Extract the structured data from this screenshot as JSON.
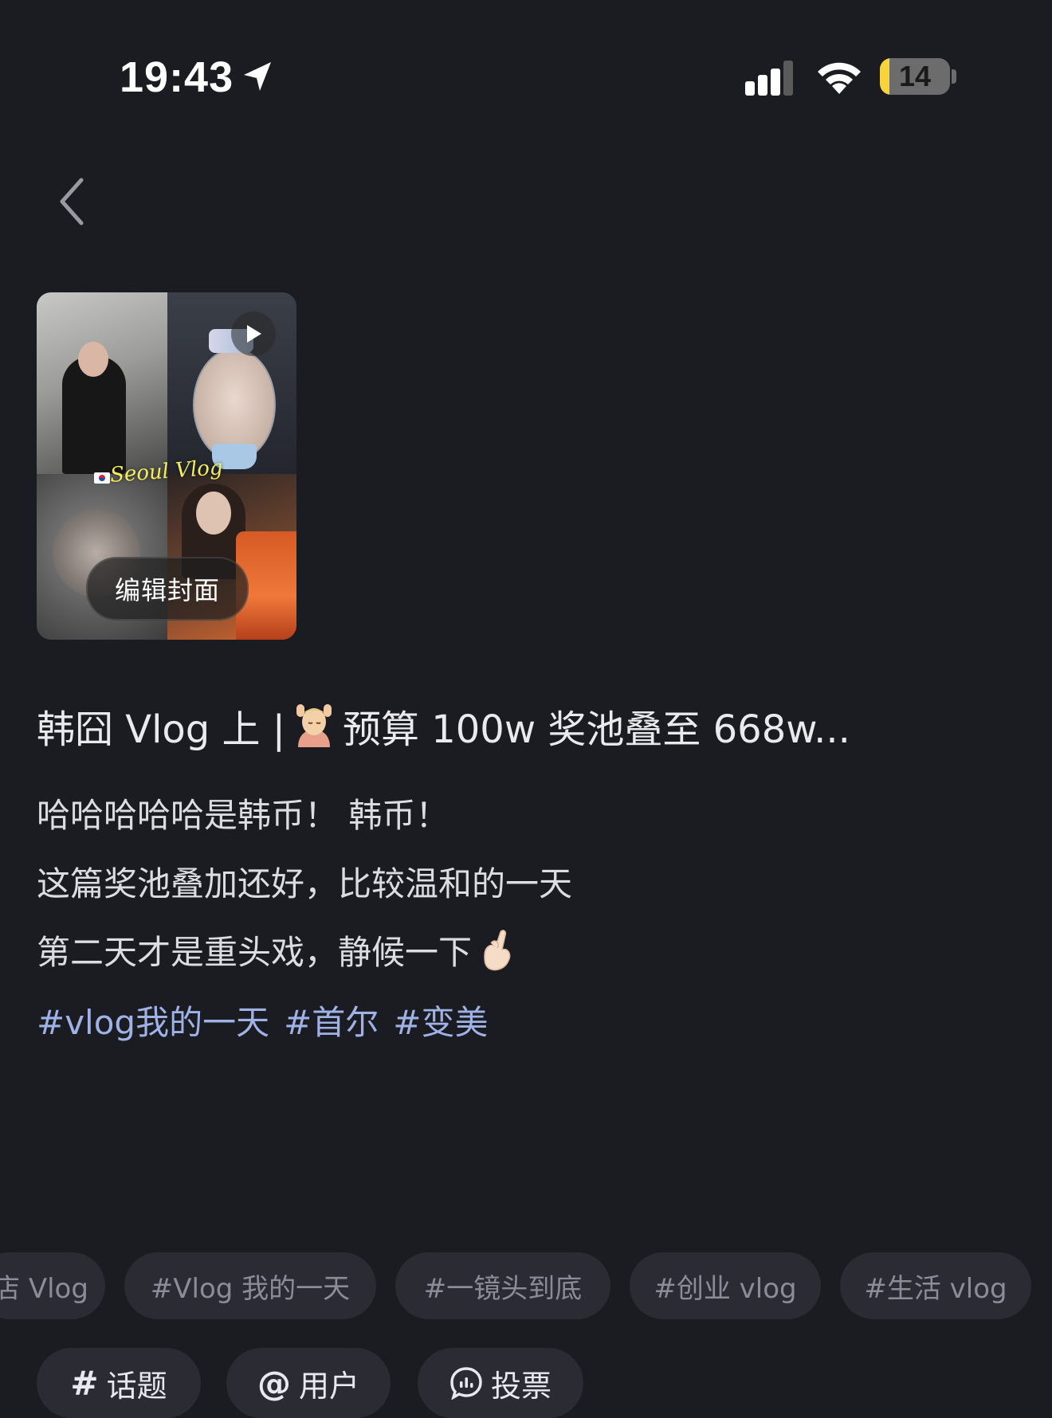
{
  "status_bar": {
    "time": "19:43",
    "battery_percent": "14",
    "battery_level": 0.14,
    "icons": [
      "location-arrow-icon",
      "cellular-signal-icon",
      "wifi-icon",
      "battery-icon"
    ]
  },
  "nav": {
    "back_icon": "chevron-left-icon"
  },
  "cover": {
    "overlay_text": "Seoul Vlog",
    "edit_label": "编辑封面",
    "play_icon": "play-icon"
  },
  "post": {
    "title_prefix": "韩囧 Vlog 上 |",
    "title_suffix": "预算 100w 奖池叠至 668w...",
    "lines": [
      "哈哈哈哈哈是韩币！ 韩币！",
      "这篇奖池叠加还好，比较温和的一天",
      "第二天才是重头戏，静候一下"
    ],
    "hashtags": [
      "#vlog我的一天",
      "#首尔",
      "#变美"
    ]
  },
  "suggested_topics": [
    "店 Vlog",
    "#Vlog 我的一天",
    "#一镜头到底",
    "#创业 vlog",
    "#生活 vlog"
  ],
  "tools": {
    "topic": {
      "glyph": "#",
      "label": "话题"
    },
    "user": {
      "glyph": "@",
      "label": "用户"
    },
    "vote": {
      "label": "投票",
      "icon": "chat-bubble-icon"
    }
  },
  "colors": {
    "background": "#1b1b22",
    "hashtag": "#9fb2e6",
    "chip_background": "#2b2b33",
    "battery_fill": "#f8d43a"
  }
}
